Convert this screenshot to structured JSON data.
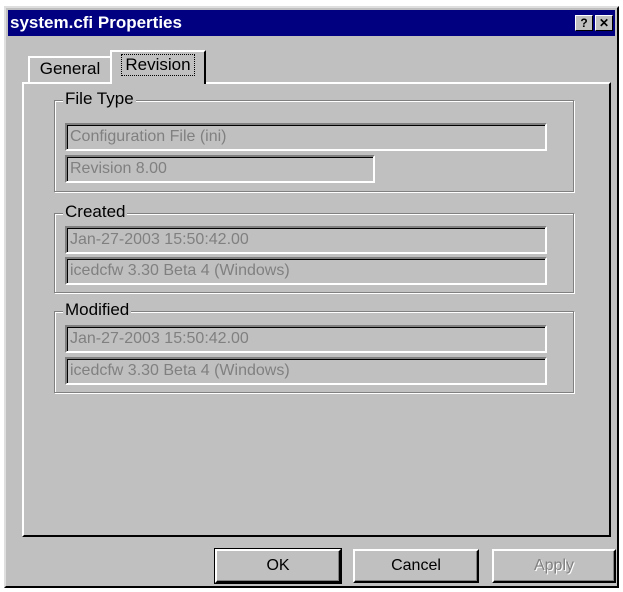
{
  "window": {
    "title": "system.cfi Properties",
    "help_glyph": "?",
    "close_glyph": "✕"
  },
  "tabs": [
    {
      "label": "General",
      "selected": false
    },
    {
      "label": "Revision",
      "selected": true
    }
  ],
  "file_type": {
    "legend": "File Type",
    "type_value": "Configuration File (ini)",
    "revision_value": "Revision 8.00"
  },
  "created": {
    "legend": "Created",
    "date_value": "Jan-27-2003 15:50:42.00",
    "app_value": "icedcfw 3.30 Beta 4 (Windows)"
  },
  "modified": {
    "legend": "Modified",
    "date_value": "Jan-27-2003 15:50:42.00",
    "app_value": "icedcfw 3.30 Beta 4 (Windows)"
  },
  "buttons": {
    "ok_label": "OK",
    "cancel_label": "Cancel",
    "apply_label": "Apply"
  }
}
